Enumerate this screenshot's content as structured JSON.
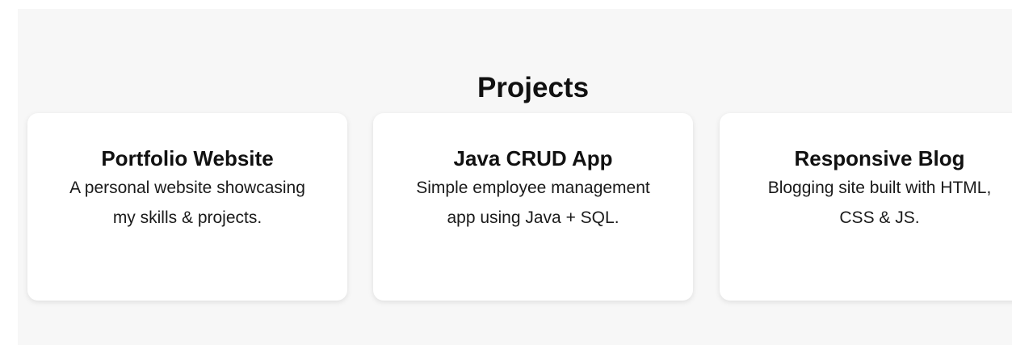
{
  "projects": {
    "heading": "Projects",
    "cards": [
      {
        "title": "Portfolio Website",
        "description": "A personal website showcasing my skills & projects."
      },
      {
        "title": "Java CRUD App",
        "description": "Simple employee management app using Java + SQL."
      },
      {
        "title": "Responsive Blog",
        "description": "Blogging site built with HTML, CSS & JS."
      }
    ]
  }
}
